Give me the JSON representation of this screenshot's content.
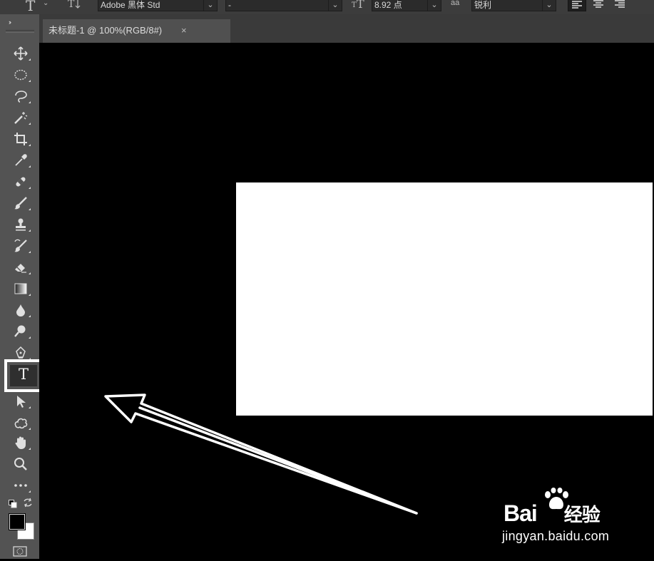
{
  "options_bar": {
    "font_family": "Adobe 黑体 Std",
    "font_style": "-",
    "font_size": "8.92 点",
    "anti_alias_label": "aa",
    "anti_alias": "锐利"
  },
  "document_tab": {
    "title": "未标题-1 @ 100%(RGB/8#)",
    "close": "×"
  },
  "toolbar": {
    "collapse_glyph": "››",
    "selected_tool": "type-tool",
    "type_glyph": "T"
  },
  "watermark": {
    "brand": "Bai",
    "brand_suffix": "经验",
    "url": "jingyan.baidu.com"
  },
  "colors": {
    "panel": "#535353",
    "optbar": "#3c3c3c",
    "canvas_bg": "#000000",
    "canvas": "#ffffff",
    "highlight": "#ffffff"
  }
}
